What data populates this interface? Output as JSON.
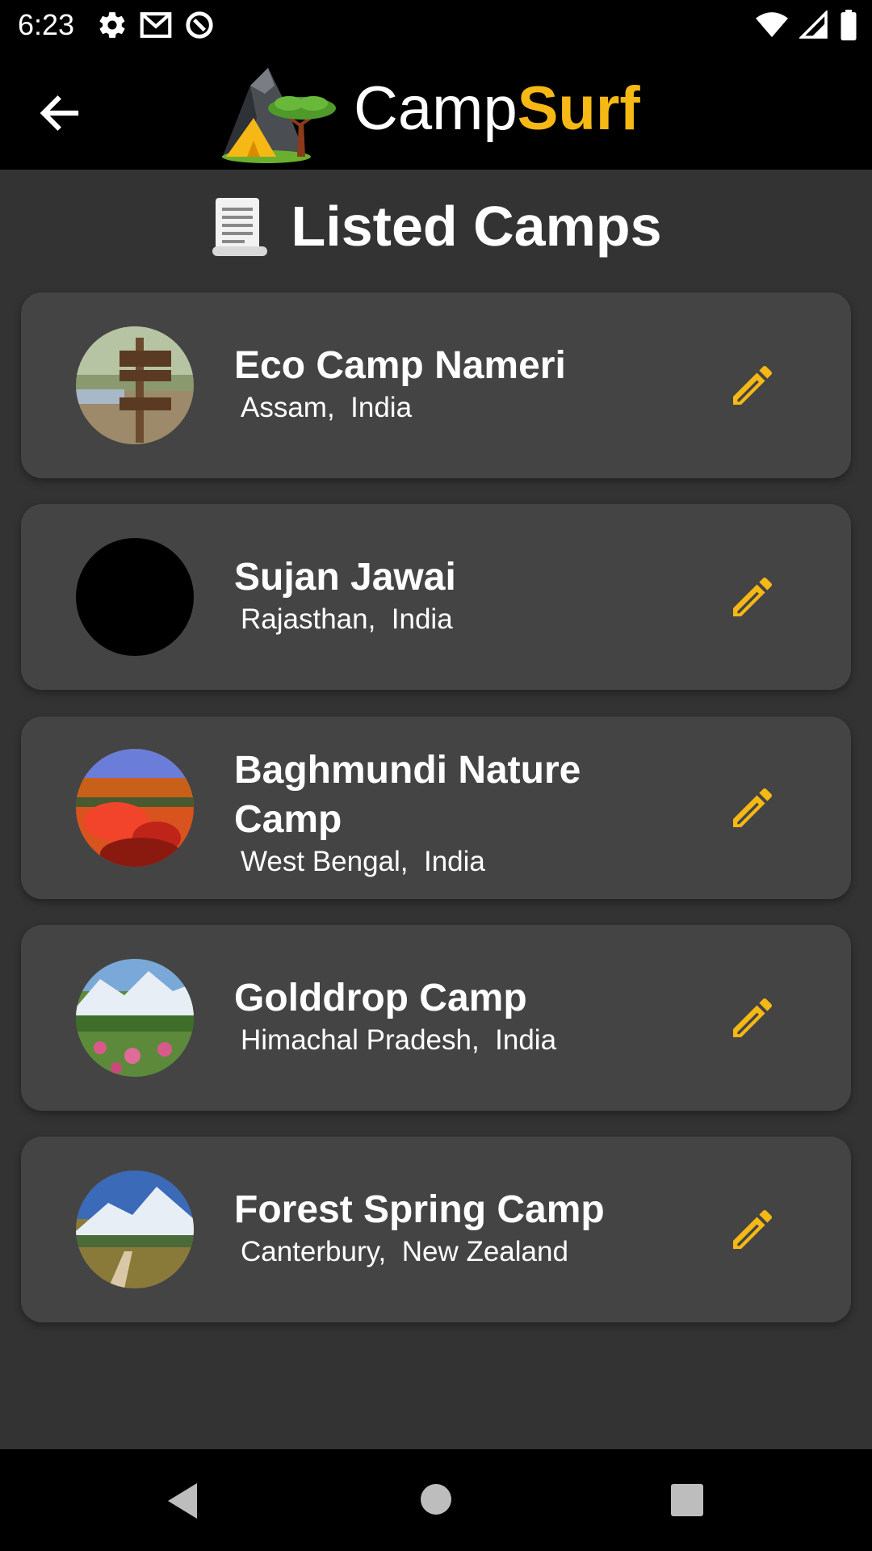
{
  "status_bar": {
    "time": "6:23",
    "left_icons": [
      "settings-icon",
      "gmail-icon",
      "data-saver-icon"
    ],
    "right_icons": [
      "wifi-icon",
      "cell-signal-icon",
      "battery-icon"
    ]
  },
  "app_bar": {
    "back_icon": "arrow-back-icon",
    "brand_part1": "Camp",
    "brand_part2": "Surf",
    "brand_colors": {
      "primary": "#FFFFFF",
      "accent": "#F5B815"
    }
  },
  "page": {
    "title_icon": "scroll-icon",
    "title": "Listed Camps"
  },
  "camps": [
    {
      "name": "Eco Camp Nameri",
      "location": "Assam,  India",
      "edit_icon": "pencil-icon"
    },
    {
      "name": "Sujan Jawai",
      "location": "Rajasthan,  India",
      "edit_icon": "pencil-icon"
    },
    {
      "name": "Baghmundi Nature Camp",
      "location": "West Bengal,  India",
      "edit_icon": "pencil-icon"
    },
    {
      "name": "Golddrop Camp",
      "location": "Himachal Pradesh,  India",
      "edit_icon": "pencil-icon"
    },
    {
      "name": "Forest Spring Camp",
      "location": "Canterbury,  New Zealand",
      "edit_icon": "pencil-icon"
    }
  ],
  "nav_bar": {
    "icons": [
      "nav-back-icon",
      "nav-home-icon",
      "nav-recents-icon"
    ]
  },
  "colors": {
    "background": "#333333",
    "card": "#444444",
    "accent": "#F5B815",
    "bars": "#000000"
  }
}
